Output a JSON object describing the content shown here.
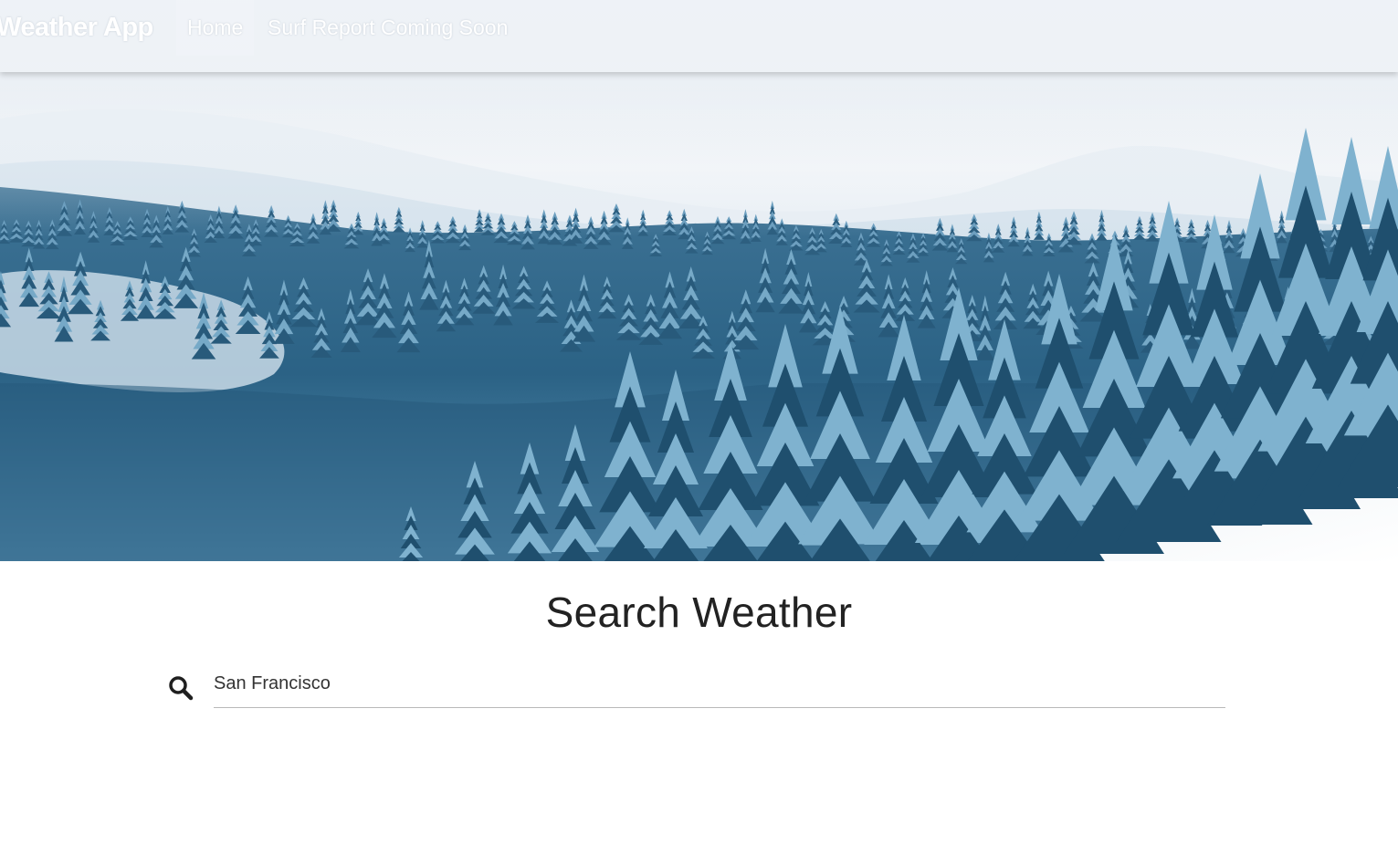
{
  "navbar": {
    "brand": "Weather App",
    "items": [
      {
        "label": "Home",
        "active": true
      },
      {
        "label": "Surf Report Coming Soon",
        "active": false
      }
    ]
  },
  "hero": {
    "image_icon": "snowy-forest-landscape"
  },
  "search": {
    "title": "Search Weather",
    "icon": "search-icon",
    "value": "San Francisco",
    "placeholder": ""
  },
  "colors": {
    "title_text": "#222222",
    "input_underline": "#b9b9b9",
    "tree_dark": "#1f4f6e",
    "tree_light": "#7fb2cf",
    "snow": "#f4f7fa"
  }
}
